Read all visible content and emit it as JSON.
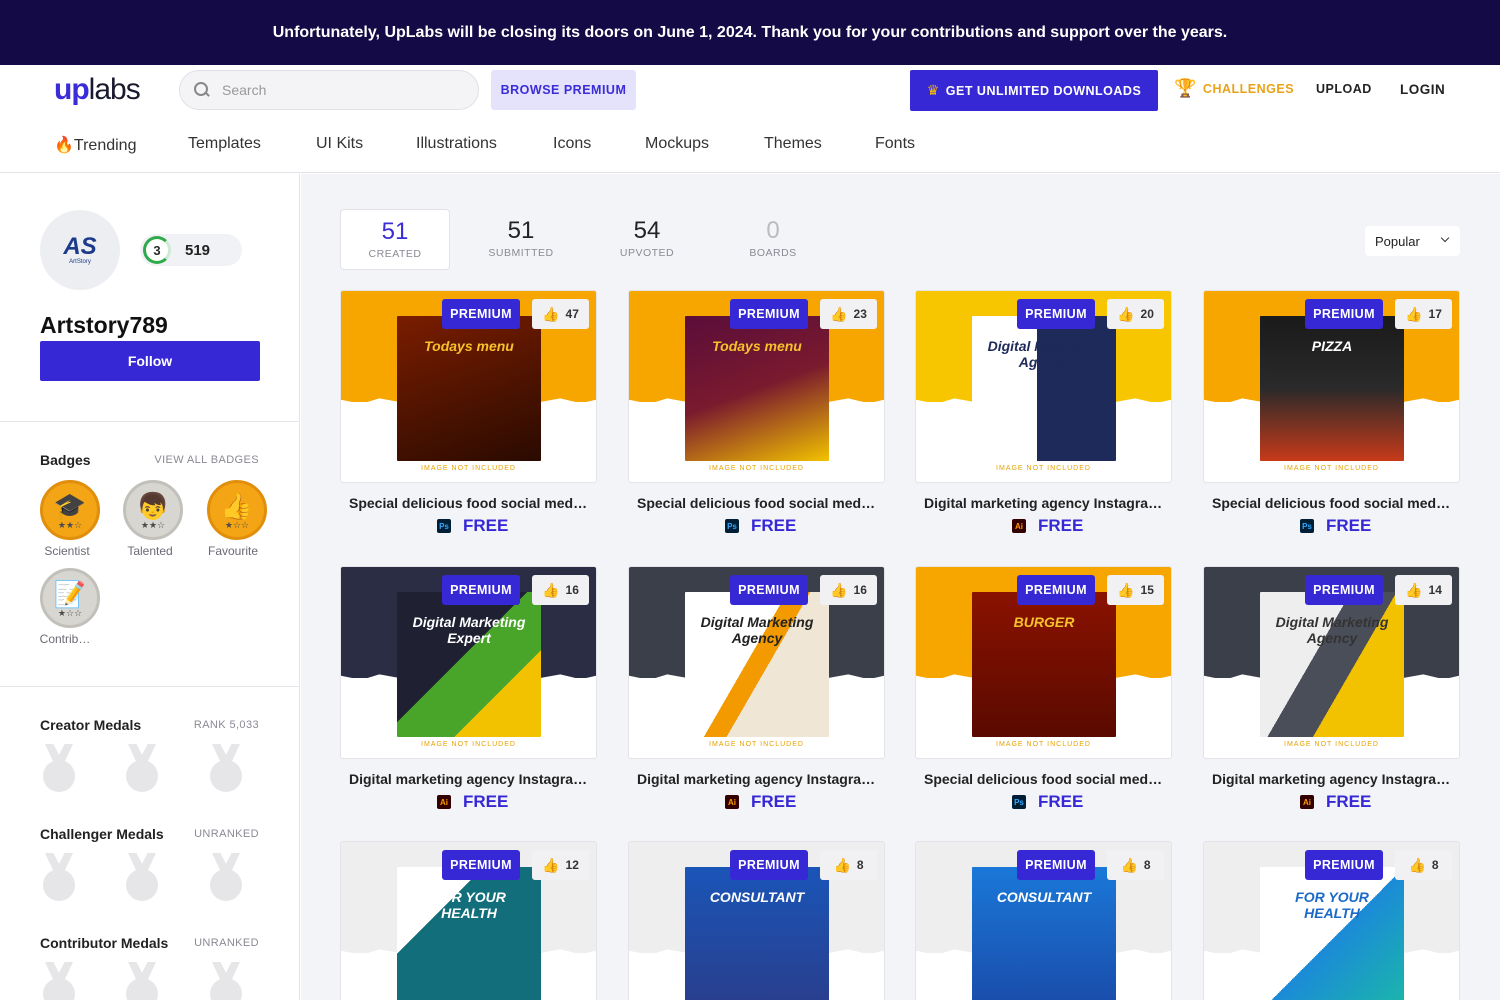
{
  "banner": {
    "text": "Unfortunately, UpLabs will be closing its doors on June 1, 2024. Thank you for your contributions and support over the years."
  },
  "header": {
    "logo_up": "up",
    "logo_labs": "labs",
    "search_placeholder": "Search",
    "browse_premium": "BROWSE PREMIUM",
    "get_unlimited": "GET UNLIMITED DOWNLOADS",
    "challenges": "CHALLENGES",
    "upload": "UPLOAD",
    "login": "LOGIN"
  },
  "categories": [
    "🔥Trending",
    "Templates",
    "UI Kits",
    "Illustrations",
    "Icons",
    "Mockups",
    "Themes",
    "Fonts"
  ],
  "profile": {
    "avatar_text": "AS",
    "avatar_sub": "ArtStory",
    "level": "3",
    "points": "519",
    "username": "Artstory789",
    "follow_label": "Follow"
  },
  "badges": {
    "title": "Badges",
    "view_all": "VIEW ALL BADGES",
    "items": [
      {
        "label": "Scientist",
        "icon": "graduation-cap-icon",
        "style": "gold"
      },
      {
        "label": "Talented",
        "icon": "person-icon",
        "style": "grey"
      },
      {
        "label": "Favourite",
        "icon": "thumbs-up-icon",
        "style": "gold"
      },
      {
        "label": "Contrib…",
        "icon": "document-icon",
        "style": "grey"
      }
    ]
  },
  "medals": [
    {
      "title": "Creator Medals",
      "rank": "RANK 5,033"
    },
    {
      "title": "Challenger Medals",
      "rank": "UNRANKED"
    },
    {
      "title": "Contributor Medals",
      "rank": "UNRANKED"
    }
  ],
  "stats": [
    {
      "num": "51",
      "label": "CREATED"
    },
    {
      "num": "51",
      "label": "SUBMITTED"
    },
    {
      "num": "54",
      "label": "UPVOTED"
    },
    {
      "num": "0",
      "label": "BOARDS"
    }
  ],
  "sort": {
    "selected": "Popular"
  },
  "cards_common": {
    "premium": "PREMIUM",
    "free": "FREE",
    "image_note": "IMAGE NOT INCLUDED"
  },
  "cards": [
    {
      "title": "Special delicious food social media ...",
      "likes": "47",
      "file": "Ps",
      "theme": "food",
      "headline": "Todays menu"
    },
    {
      "title": "Special delicious food social media ...",
      "likes": "23",
      "file": "Ps",
      "theme": "food2",
      "headline": "Todays menu"
    },
    {
      "title": "Digital marketing agency Instagram ...",
      "likes": "20",
      "file": "Ai",
      "theme": "agency-y",
      "headline": "Digital Marketing Agency"
    },
    {
      "title": "Special delicious food social media ...",
      "likes": "17",
      "file": "Ps",
      "theme": "pizza",
      "headline": "PIZZA"
    },
    {
      "title": "Digital marketing agency Instagram ...",
      "likes": "16",
      "file": "Ai",
      "theme": "agency-d",
      "headline": "Digital Marketing Expert"
    },
    {
      "title": "Digital marketing agency Instagram ...",
      "likes": "16",
      "file": "Ai",
      "theme": "agency-g",
      "headline": "Digital Marketing Agency"
    },
    {
      "title": "Special delicious food social media ...",
      "likes": "15",
      "file": "Ps",
      "theme": "burger",
      "headline": "BURGER"
    },
    {
      "title": "Digital marketing agency Instagram ...",
      "likes": "14",
      "file": "Ai",
      "theme": "agency-g2",
      "headline": "Digital Marketing Agency"
    },
    {
      "title": "",
      "likes": "12",
      "file": "",
      "theme": "health",
      "headline": "FOR YOUR HEALTH"
    },
    {
      "title": "",
      "likes": "8",
      "file": "",
      "theme": "consult",
      "headline": "CONSULTANT"
    },
    {
      "title": "",
      "likes": "8",
      "file": "",
      "theme": "consult2",
      "headline": "CONSULTANT"
    },
    {
      "title": "",
      "likes": "8",
      "file": "",
      "theme": "health2",
      "headline": "FOR YOUR HEALTH"
    }
  ]
}
